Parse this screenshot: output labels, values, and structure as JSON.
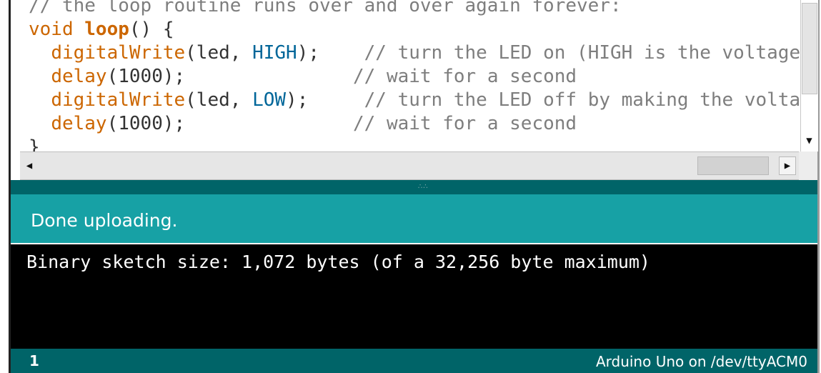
{
  "editor": {
    "lines": [
      {
        "comment": "// the loop routine runs over and over again forever:"
      },
      {
        "kw": "void",
        "sp": " ",
        "fn": "loop",
        "rest": "() {"
      },
      {
        "indent": "  ",
        "fn": "digitalWrite",
        "pre": "(led, ",
        "const": "HIGH",
        "post": ");    ",
        "comment": "// turn the LED on (HIGH is the voltage level)"
      },
      {
        "indent": "  ",
        "fn": "delay",
        "pre": "(1000);",
        "pad": "               ",
        "comment": "// wait for a second"
      },
      {
        "indent": "  ",
        "fn": "digitalWrite",
        "pre": "(led, ",
        "const": "LOW",
        "post": ");     ",
        "comment": "// turn the LED off by making the voltage LOW"
      },
      {
        "indent": "  ",
        "fn": "delay",
        "pre": "(1000);",
        "pad": "               ",
        "comment": "// wait for a second"
      },
      {
        "rest": "}"
      }
    ]
  },
  "scrollbars": {
    "down_arrow": "▼",
    "left_arrow": "◀",
    "right_arrow": "▶"
  },
  "divider": {
    "grip": "∴∴"
  },
  "message": {
    "text": "Done uploading."
  },
  "console": {
    "text": "Binary sketch size: 1,072 bytes (of a 32,256 byte maximum)"
  },
  "status": {
    "line_number": "1",
    "board": "Arduino Uno on /dev/ttyACM0"
  },
  "colors": {
    "keyword": "#cc6600",
    "constant": "#006699",
    "comment": "#7e7e7e",
    "message_bar": "#17a1a5",
    "status_bar": "#006468",
    "console_bg": "#000000"
  }
}
